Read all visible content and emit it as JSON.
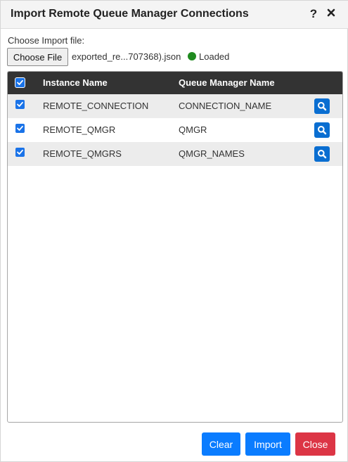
{
  "dialog": {
    "title": "Import Remote Queue Manager Connections",
    "help_label": "?"
  },
  "file": {
    "label": "Choose Import file:",
    "choose_button": "Choose File",
    "file_name": "exported_re...707368).json",
    "status": "Loaded",
    "status_color": "#1f8a1f"
  },
  "table": {
    "columns": [
      "Instance Name",
      "Queue Manager Name"
    ],
    "header_checked": true,
    "rows": [
      {
        "checked": true,
        "instance": "REMOTE_CONNECTION",
        "qmgr": "CONNECTION_NAME"
      },
      {
        "checked": true,
        "instance": "REMOTE_QMGR",
        "qmgr": "QMGR"
      },
      {
        "checked": true,
        "instance": "REMOTE_QMGRS",
        "qmgr": "QMGR_NAMES"
      }
    ],
    "row_action_icon": "search-icon"
  },
  "footer": {
    "clear_label": "Clear",
    "import_label": "Import",
    "close_label": "Close"
  },
  "colors": {
    "header_bg": "#333333",
    "primary": "#0a7cff",
    "danger": "#dc3545",
    "checkbox": "#1a73e8"
  }
}
